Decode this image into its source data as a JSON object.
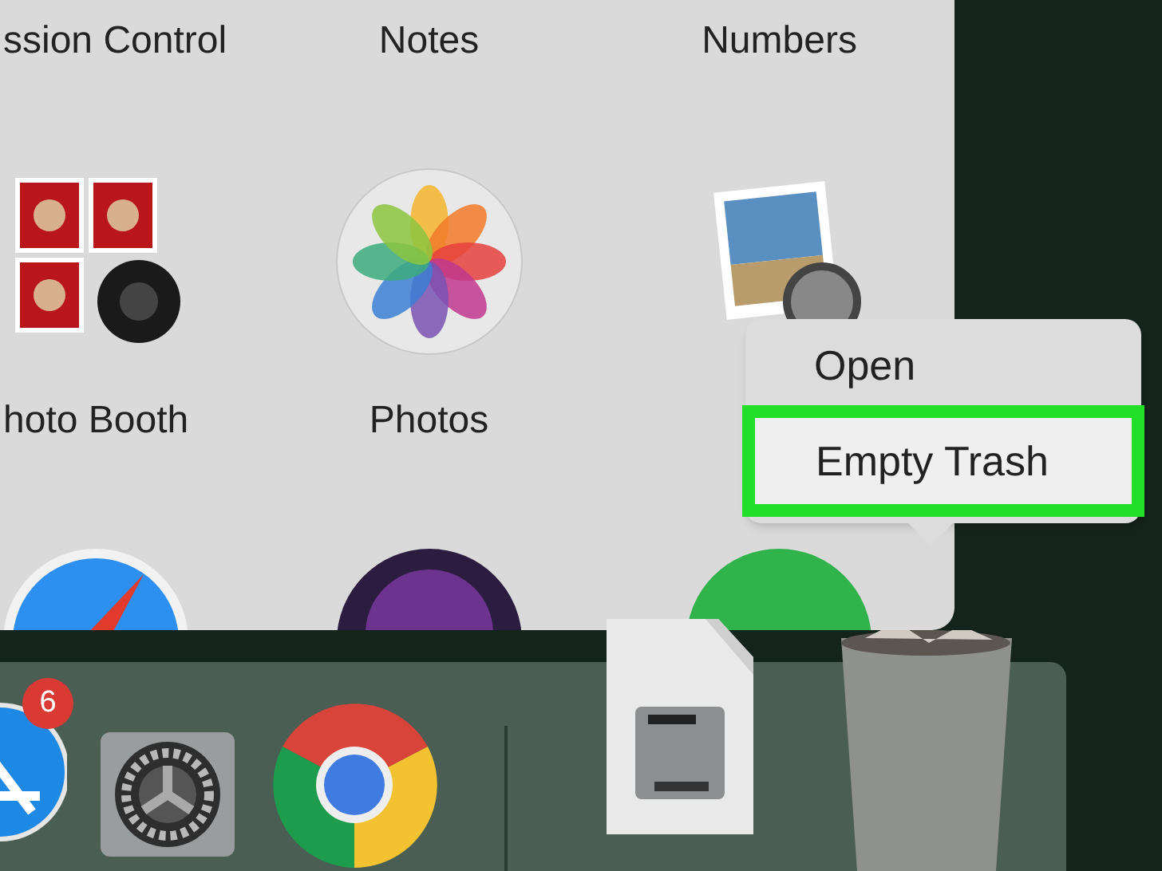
{
  "launchpad": {
    "top_labels": [
      "ssion Control",
      "Notes",
      "Numbers"
    ],
    "apps": [
      {
        "label": "hoto Booth"
      },
      {
        "label": "Photos"
      }
    ]
  },
  "context_menu": {
    "items": [
      {
        "label": "Open",
        "selected": false
      },
      {
        "label": "Empty Trash",
        "selected": true
      }
    ]
  },
  "dock": {
    "badge": "6"
  }
}
